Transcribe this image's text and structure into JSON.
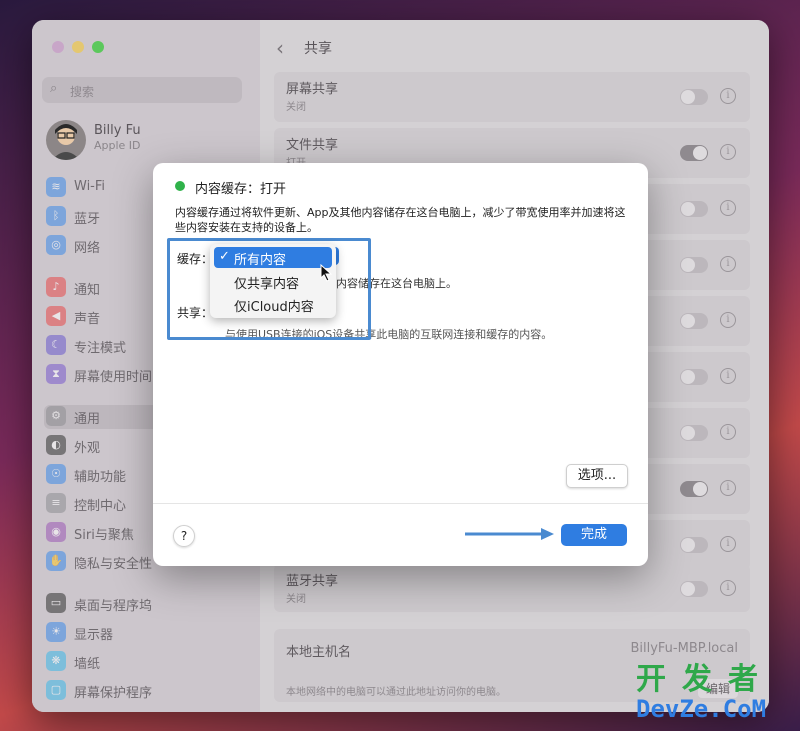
{
  "sidebar": {
    "search_placeholder": "搜索",
    "user": {
      "name": "Billy Fu",
      "subtitle": "Apple ID"
    },
    "items": [
      {
        "label": "Wi-Fi",
        "icon": "wifi-icon",
        "color": "#3d8be8"
      },
      {
        "label": "蓝牙",
        "icon": "bluetooth-icon",
        "color": "#3d8be8"
      },
      {
        "label": "网络",
        "icon": "globe-icon",
        "color": "#3d8be8"
      },
      {
        "label": "通知",
        "icon": "bell-icon",
        "color": "#e84a4a"
      },
      {
        "label": "声音",
        "icon": "speaker-icon",
        "color": "#e84a4a"
      },
      {
        "label": "专注模式",
        "icon": "moon-icon",
        "color": "#6a5acd"
      },
      {
        "label": "屏幕使用时间",
        "icon": "hourglass-icon",
        "color": "#7a5acd"
      },
      {
        "label": "通用",
        "icon": "gear-icon",
        "color": "#8e8e93"
      },
      {
        "label": "外观",
        "icon": "appearance-icon",
        "color": "#333333"
      },
      {
        "label": "辅助功能",
        "icon": "accessibility-icon",
        "color": "#3d8be8"
      },
      {
        "label": "控制中心",
        "icon": "control-center-icon",
        "color": "#8e8e93"
      },
      {
        "label": "Siri与聚焦",
        "icon": "siri-icon",
        "color": "#9b59b6"
      },
      {
        "label": "隐私与安全性",
        "icon": "hand-icon",
        "color": "#3d8be8"
      },
      {
        "label": "桌面与程序坞",
        "icon": "dock-icon",
        "color": "#333333"
      },
      {
        "label": "显示器",
        "icon": "display-icon",
        "color": "#3d8be8"
      },
      {
        "label": "墙纸",
        "icon": "wallpaper-icon",
        "color": "#3db8e8"
      },
      {
        "label": "屏幕保护程序",
        "icon": "screensaver-icon",
        "color": "#3db8e8"
      }
    ]
  },
  "main": {
    "title": "共享",
    "rows": [
      {
        "title": "屏幕共享",
        "status": "关闭",
        "on": false
      },
      {
        "title": "文件共享",
        "status": "打开",
        "on": true
      },
      {
        "title": "",
        "status": "",
        "on": false
      },
      {
        "title": "",
        "status": "",
        "on": false
      },
      {
        "title": "",
        "status": "",
        "on": false
      },
      {
        "title": "",
        "status": "",
        "on": false
      },
      {
        "title": "",
        "status": "",
        "on": false
      },
      {
        "title": "",
        "status": "",
        "on": true
      },
      {
        "title": "",
        "status": "",
        "on": false
      },
      {
        "title": "蓝牙共享",
        "status": "关闭",
        "on": false
      }
    ],
    "hostname_label": "本地主机名",
    "hostname_value": "BillyFu-MBP.local",
    "hostname_desc": "本地网络中的电脑可以通过此地址访问你的电脑。",
    "edit_button": "编辑"
  },
  "dialog": {
    "status_title": "内容缓存：打开",
    "status_color": "#2fb24a",
    "description": "内容缓存通过将软件更新、App及其他内容储存在这台电脑上，减少了带宽使用率并加速将这些内容安装在支持的设备上。",
    "cache_label": "缓存：",
    "cache_hint": "内容储存在这台电脑上。",
    "share_label": "共享：",
    "share_hint": "与使用USB连接的iOS设备共享此电脑的互联网连接和缓存的内容。",
    "menu": {
      "selected": "所有内容",
      "options": [
        "所有内容",
        "仅共享内容",
        "仅iCloud内容"
      ]
    },
    "options_button": "选项...",
    "help_button": "?",
    "done_button": "完成",
    "accent": "#2f7de1"
  },
  "watermark": {
    "line1": "开发者",
    "line2": "DevZe.CoM"
  }
}
